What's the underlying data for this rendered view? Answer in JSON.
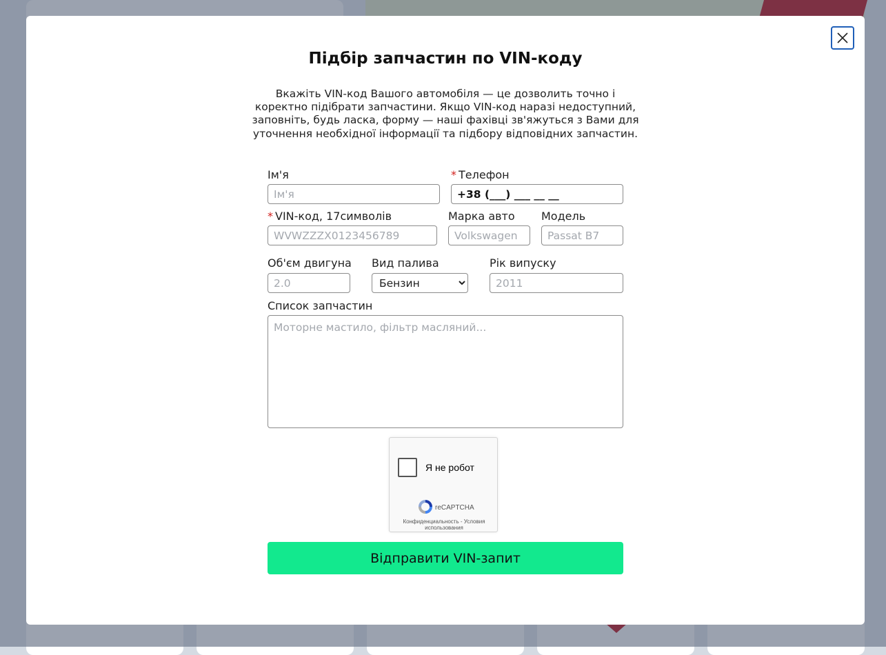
{
  "modal": {
    "title": "Підбір запчастин по VIN-коду",
    "description": "Вкажіть VIN-код Вашого автомобіля — це дозволить точно і коректно підібрати запчастини. Якщо VIN-код наразі недоступний, заповніть, будь ласка, форму — наші фахівці зв'яжуться з Вами для уточнення необхідної інформації та підбору відповідних запчастин.",
    "close_icon": "close-icon"
  },
  "form": {
    "required_mark": "*",
    "name": {
      "label": "Ім'я",
      "placeholder": "Ім'я",
      "value": ""
    },
    "phone": {
      "label": "Телефон",
      "value": "+38 (___) ___ __ __",
      "required": true
    },
    "vin": {
      "label": "VIN-код, 17символів",
      "placeholder": "WVWZZZX0123456789",
      "required": true
    },
    "brand": {
      "label": "Марка авто",
      "placeholder": "Volkswagen"
    },
    "model": {
      "label": "Модель",
      "placeholder": "Passat B7"
    },
    "engine": {
      "label": "Об'єм двигуна",
      "placeholder": "2.0"
    },
    "fuel": {
      "label": "Вид палива",
      "selected": "Бензин"
    },
    "year": {
      "label": "Рік випуску",
      "placeholder": "2011"
    },
    "parts": {
      "label": "Список запчастин",
      "placeholder": "Моторне мастило, фільтр масляний..."
    },
    "submit_label": "Відправити VIN-запит"
  },
  "captcha": {
    "label": "Я не робот",
    "brand": "reCAPTCHA",
    "links": "Конфиденциальность - Условия использования",
    "checked": false
  },
  "colors": {
    "accent": "#12e98e",
    "close_border": "#1f5fb8",
    "required": "#d2201c"
  }
}
